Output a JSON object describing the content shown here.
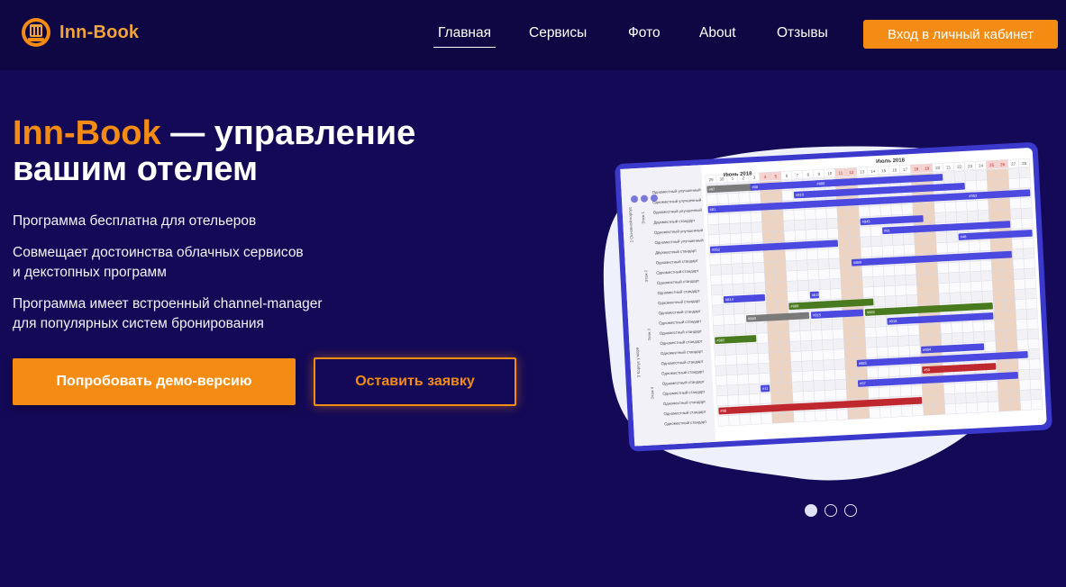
{
  "header": {
    "logo_text": "Inn-Book",
    "nav": [
      {
        "label": "Главная",
        "active": true
      },
      {
        "label": "Сервисы",
        "active": false
      },
      {
        "label": "Фото",
        "active": false
      },
      {
        "label": "About",
        "active": false
      },
      {
        "label": "Отзывы",
        "active": false
      }
    ],
    "cta_label": "Вход в личный кабинет"
  },
  "hero": {
    "title_brand": "Inn-Book",
    "title_rest_1": " — управление",
    "title_rest_2": "вашим отелем",
    "feature_1": "Программа бесплатна для отельеров",
    "feature_2_line_1": "Совмещает достоинства облачных сервисов",
    "feature_2_line_2": "и декстопных программ",
    "feature_3_line_1": "Программа имеет встроенный channel-manager",
    "feature_3_line_2": "для популярных систем бронирования",
    "primary_button": "Попробовать демо-версию",
    "secondary_button": "Оставить заявку"
  },
  "schedule": {
    "month_1": "Июнь 2018",
    "month_2": "Июль 2018",
    "days": [
      "29",
      "30",
      "1",
      "2",
      "3",
      "4",
      "5",
      "6",
      "7",
      "8",
      "9",
      "10",
      "11",
      "12",
      "13",
      "14",
      "15",
      "16",
      "17",
      "18",
      "19",
      "20",
      "21",
      "22",
      "23",
      "24",
      "25",
      "26",
      "27",
      "28"
    ],
    "groups": [
      "1 Основной корпус",
      "3 Корпус у моря"
    ],
    "floors": [
      "Этаж 1",
      "Этаж 2",
      "Этаж 3",
      "Этаж 4"
    ],
    "rooms": [
      "Одноместный улучшенный",
      "Одноместный улучшенный",
      "Одноместный улучшенный",
      "Двухместный стандарт",
      "Одноместный улучшенный",
      "Одноместный улучшенный",
      "Двухместный стандарт",
      "Одноместный стандарт",
      "Одноместный стандарт",
      "Одноместный стандарт",
      "Одноместный стандарт",
      "Одноместный стандарт",
      "Одноместный стандарт",
      "Одноместный стандарт",
      "Одноместный стандарт",
      "Одноместный стандарт",
      "Одноместный стандарт",
      "Одноместный стандарт",
      "Одноместный стандарт",
      "Одноместный стандарт",
      "Одноместный стандарт",
      "Одноместный стандарт",
      "Одноместный стандарт",
      "Одноместный стандарт"
    ],
    "bookings": [
      "#97",
      "#98",
      "#880",
      "#910",
      "#81",
      "#953",
      "#943",
      "#81",
      "#952",
      "#48",
      "#889",
      "#814",
      "#815",
      "#888",
      "#880",
      "#915",
      "#883",
      "#916",
      "#882",
      "#904",
      "#885",
      "#50",
      "#11"
    ]
  },
  "carousel": {
    "count": 3,
    "active_index": 0
  },
  "colors": {
    "background": "#130957",
    "header": "#0e0744",
    "accent": "#f48c13",
    "booking_blue": "#4b49e0",
    "booking_green": "#4a7a1f",
    "booking_red": "#c0282f",
    "booking_gray": "#7a7a7a"
  }
}
